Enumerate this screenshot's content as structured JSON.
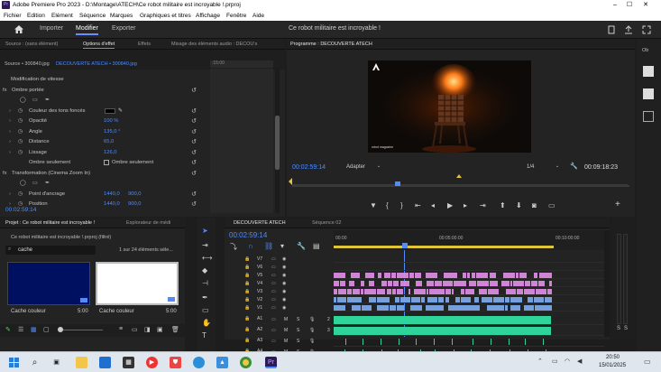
{
  "window": {
    "app_badge": "Pr",
    "title": "Adobe Premiere Pro 2023 - D:\\Montage\\ATECH\\Ce robot militaire est incroyable !.prproj",
    "minimize": "–",
    "maximize": "☐",
    "close": "✕"
  },
  "menu": [
    "Fichier",
    "Edition",
    "Elément",
    "Séquence",
    "Marques",
    "Graphiques et titres",
    "Affichage",
    "Fenêtre",
    "Aide"
  ],
  "header": {
    "workspaces": [
      "Importer",
      "Modifier",
      "Exporter"
    ],
    "active": "Modifier",
    "document_title": "Ce robot militaire est incroyable !"
  },
  "effects_panel": {
    "tabs": [
      "Source : (sans élément)",
      "Options d'effet",
      "Effets",
      "Mixage des éléments audio : DECOU's"
    ],
    "source_label": "Source • 300840.jpg",
    "sequence_label": "DECOUVERTE ATECH • 300840.jpg",
    "ruler_time": ":15:00",
    "rows": [
      {
        "type": "hdr",
        "label": "Modification de vitesse"
      },
      {
        "type": "fx",
        "label": "Ombre portée"
      },
      {
        "type": "icons"
      },
      {
        "type": "param",
        "label": "Couleur des tons foncés",
        "color": "#000000"
      },
      {
        "type": "param",
        "label": "Opacité",
        "value": "100 %"
      },
      {
        "type": "param",
        "label": "Angle",
        "value": "135,0 °"
      },
      {
        "type": "param",
        "label": "Distance",
        "value": "65,0"
      },
      {
        "type": "param",
        "label": "Lissage",
        "value": "126,0"
      },
      {
        "type": "check",
        "label": "Ombre seulement",
        "checkbox": "Ombre seulement"
      },
      {
        "type": "fx",
        "label": "Transformation (Cinema Zoom In)"
      },
      {
        "type": "icons"
      },
      {
        "type": "param",
        "label": "Point d'ancrage",
        "value": "1440,0",
        "value2": "900,0"
      },
      {
        "type": "param",
        "label": "Position",
        "value": "1440,0",
        "value2": "900,0"
      }
    ],
    "timecode": "00:02:59:14"
  },
  "program_monitor": {
    "title": "Programme : DECOUVERTE ATECH",
    "current_time": "00:02:59:14",
    "fit": "Adapter",
    "resolution": "1/4",
    "duration": "00:09:18:23",
    "watermark": "robot magazine"
  },
  "project_panel": {
    "title": "Projet : Ce robot militaire est incroyable !",
    "tab2": "Explorateur de médi",
    "file": "Ce robot militaire est incroyable !.prproj (filtré)",
    "search": "cache",
    "count": "1 sur 24 éléments séle...",
    "items": [
      {
        "name": "Cache couleur",
        "duration": "5:00",
        "color": "#001060"
      },
      {
        "name": "Cache couleur",
        "duration": "5:00",
        "color": "#ffffff"
      }
    ]
  },
  "timeline": {
    "tabs": [
      "DECOUVERTE ATECH",
      "Séquence 02"
    ],
    "timecode": "00:02:59:14",
    "ruler": [
      "00:00",
      "00:05:00:00",
      "00:10:00:00"
    ],
    "video_tracks": [
      "V7",
      "V6",
      "V5",
      "V4",
      "V3",
      "V2",
      "V1"
    ],
    "audio_tracks": [
      "A1",
      "A2",
      "A3",
      "A4"
    ],
    "track_buttons": [
      "M",
      "S"
    ],
    "audio_labels": [
      "2",
      "3"
    ]
  },
  "taskbar": {
    "time": "20:50",
    "date": "15/01/2025"
  },
  "colors": {
    "accent": "#4f8cff",
    "video_clip": "#d98ae0",
    "video_clip2": "#7aa8e8",
    "audio_clip": "#2fd49a"
  }
}
